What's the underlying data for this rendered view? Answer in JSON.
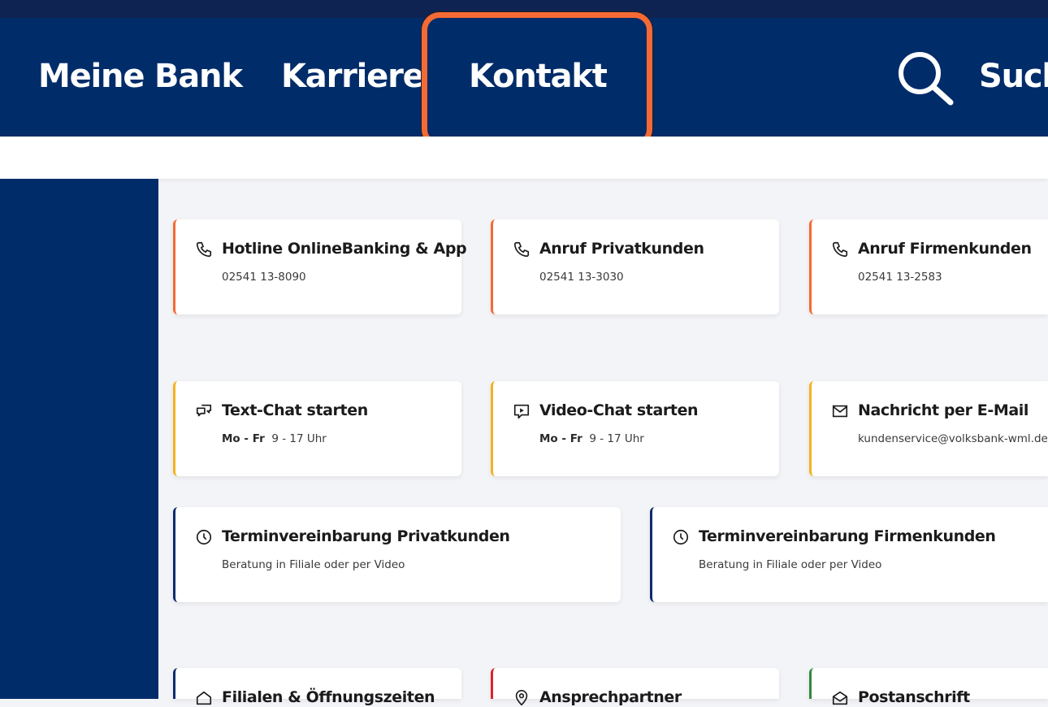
{
  "nav": {
    "items": [
      "Meine Bank",
      "Karriere",
      "Kontakt"
    ],
    "search_label": "Suche"
  },
  "cards": [
    {
      "title": "Hotline OnlineBanking & App",
      "sub": "02541 13-8090",
      "icon": "phone-icon"
    },
    {
      "title": "Anruf Privatkunden",
      "sub": "02541 13-3030",
      "icon": "phone-icon"
    },
    {
      "title": "Anruf Firmenkunden",
      "sub": "02541 13-2583",
      "icon": "phone-icon"
    },
    {
      "title": "Text-Chat starten",
      "sub_bold": "Mo - Fr",
      "sub": "9 - 17 Uhr",
      "icon": "chat-icon"
    },
    {
      "title": "Video-Chat starten",
      "sub_bold": "Mo - Fr",
      "sub": "9 - 17 Uhr",
      "icon": "video-chat-icon"
    },
    {
      "title": "Nachricht per E-Mail",
      "sub": "kundenservice@volksbank-wml.de",
      "icon": "mail-icon"
    },
    {
      "title": "Terminvereinbarung Privatkunden",
      "sub": "Beratung in Filiale oder per Video",
      "icon": "clock-icon"
    },
    {
      "title": "Terminvereinbarung Firmenkunden",
      "sub": "Beratung in Filiale oder per Video",
      "icon": "clock-icon"
    },
    {
      "title": "Filialen & Öffnungszeiten",
      "icon": "home-icon"
    },
    {
      "title": "Ansprechpartner",
      "icon": "location-pin-icon"
    },
    {
      "title": "Postanschrift",
      "icon": "envelope-open-icon"
    }
  ],
  "colors": {
    "navbar": "#002c6a",
    "highlight": "#f46a34",
    "accent_orange": "#f46a34",
    "accent_yellow": "#f5b21f",
    "accent_navy": "#0d2b6e",
    "accent_red": "#d9262c",
    "accent_green": "#2f8a3f"
  }
}
